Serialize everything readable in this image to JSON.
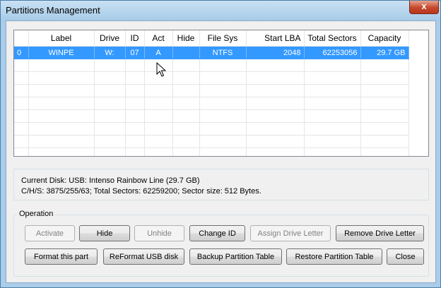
{
  "window": {
    "title": "Partitions Management",
    "close_label": "x"
  },
  "table": {
    "columns": [
      "",
      "Label",
      "Drive",
      "ID",
      "Act",
      "Hide",
      "File Sys",
      "Start LBA",
      "Total Sectors",
      "Capacity"
    ],
    "rows": [
      {
        "index": "0",
        "label": "WINPE",
        "drive": "W:",
        "id": "07",
        "act": "A",
        "hide": "",
        "filesys": "NTFS",
        "start_lba": "2048",
        "total_sectors": "62253056",
        "capacity": "29.7 GB",
        "selected": true
      }
    ]
  },
  "disk_info": {
    "line1": "Current Disk:   USB: Intenso Rainbow Line (29.7 GB)",
    "line2": "C/H/S: 3875/255/63; Total Sectors: 62259200; Sector size: 512 Bytes."
  },
  "operation": {
    "group_label": "Operation",
    "buttons": {
      "activate": "Activate",
      "hide": "Hide",
      "unhide": "Unhide",
      "change_id": "Change ID",
      "assign_drive_letter": "Assign Drive Letter",
      "remove_drive_letter": "Remove Drive Letter",
      "format_part": "Format this part",
      "reformat_usb": "ReFormat USB disk",
      "backup_table": "Backup Partition Table",
      "restore_table": "Restore Partition Table",
      "close": "Close"
    }
  }
}
